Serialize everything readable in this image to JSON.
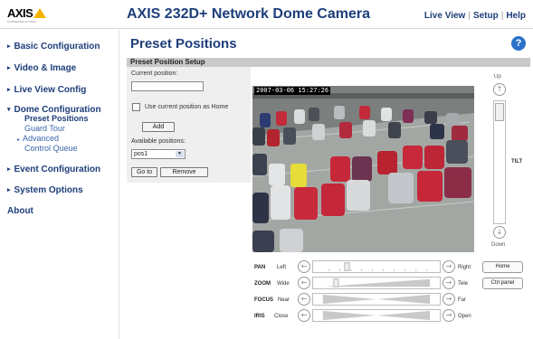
{
  "header": {
    "logo_text": "AXIS",
    "logo_tagline": "COMMUNICATIONS",
    "app_title": "AXIS 232D+ Network Dome Camera",
    "nav": [
      "Live View",
      "Setup",
      "Help"
    ],
    "nav_separator": "|"
  },
  "sidebar": {
    "items": [
      {
        "label": "Basic Configuration"
      },
      {
        "label": "Video & Image"
      },
      {
        "label": "Live View Config"
      },
      {
        "label": "Dome Configuration"
      },
      {
        "label": "Event Configuration"
      },
      {
        "label": "System Options"
      },
      {
        "label": "About"
      }
    ],
    "dome_sub": [
      "Preset Positions",
      "Guard Tour",
      "Advanced",
      "Control Queue"
    ]
  },
  "main": {
    "page_title": "Preset Positions",
    "help_icon": "?",
    "section_title": "Preset Position Setup",
    "current_position_label": "Current position:",
    "current_position_value": "",
    "use_current_label": "Use current position as Home",
    "add_button": "Add",
    "available_label": "Available positions:",
    "selected_position": "pos1",
    "goto_button": "Go to",
    "remove_button": "Remove"
  },
  "video": {
    "timestamp": "2007-03-06 15:27:26"
  },
  "tilt": {
    "up_label": "Up",
    "down_label": "Down",
    "tilt_label": "TILT"
  },
  "controls": {
    "pan": {
      "label": "PAN",
      "left": "Left",
      "right": "Right"
    },
    "zoom": {
      "label": "ZOOM",
      "left": "Wide",
      "right": "Tele"
    },
    "focus": {
      "label": "FOCUS",
      "left": "Near",
      "right": "Far"
    },
    "iris": {
      "label": "IRIS",
      "left": "Close",
      "right": "Open"
    },
    "home_button": "Home",
    "ctrl_panel_button": "Ctrl panel"
  },
  "colors": {
    "brand_blue": "#1d3e7a",
    "link_blue": "#3a65aa",
    "logo_yellow": "#f5b400",
    "section_gray": "#c9c9c9"
  }
}
